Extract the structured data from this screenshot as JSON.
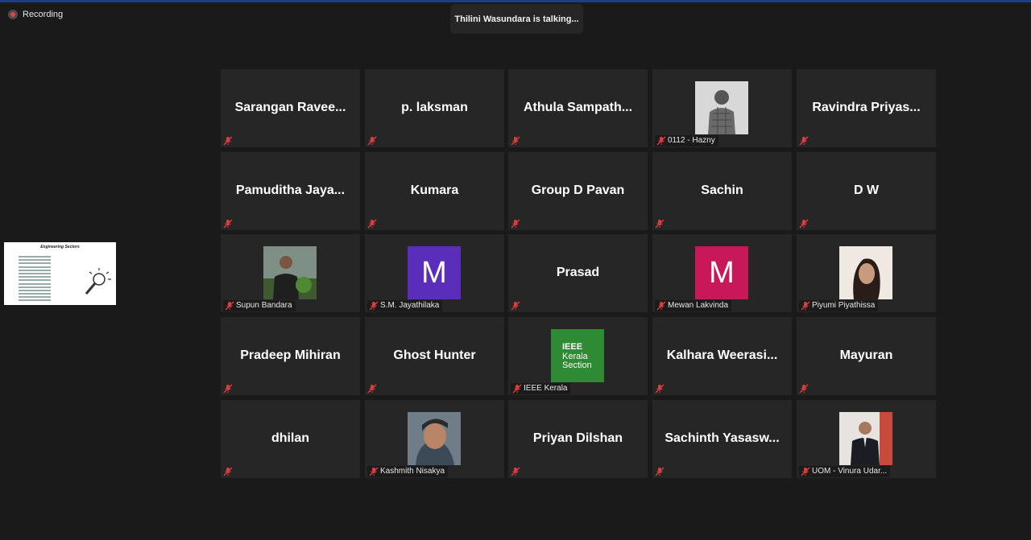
{
  "recording_label": "Recording",
  "talking_banner": "Thilini Wasundara is talking...",
  "share_preview": {
    "title": "Engineering Sectors"
  },
  "colors": {
    "mute_icon": "#e03c3c",
    "avatar_purple": "#5a2dbb",
    "avatar_pink": "#c8185a",
    "ieee_green": "#2e8b34"
  },
  "tiles": [
    {
      "name": "Sarangan  Ravee..."
    },
    {
      "name": "p. laksman"
    },
    {
      "name": "Athula  Sampath..."
    },
    {
      "label": "0112 - Hazny"
    },
    {
      "name": "Ravindra  Priyas..."
    },
    {
      "name": "Pamuditha  Jaya..."
    },
    {
      "name": "Kumara"
    },
    {
      "name": "Group D Pavan"
    },
    {
      "name": "Sachin"
    },
    {
      "name": "D W"
    },
    {
      "label": "Supun Bandara"
    },
    {
      "label": "S.M. Jayathilaka",
      "avatar_letter": "M"
    },
    {
      "name": "Prasad"
    },
    {
      "label": "Mewan Lakvinda",
      "avatar_letter": "M"
    },
    {
      "label": "Piyumi Piyathissa"
    },
    {
      "name": "Pradeep Mihiran"
    },
    {
      "name": "Ghost Hunter"
    },
    {
      "label": "IEEE Kerala",
      "logo_text": [
        "IEEE",
        "Kerala",
        "Section"
      ]
    },
    {
      "name": "Kalhara  Weerasi..."
    },
    {
      "name": "Mayuran"
    },
    {
      "name": "dhilan"
    },
    {
      "label": "Kashmith Nisakya"
    },
    {
      "name": "Priyan Dilshan"
    },
    {
      "name": "Sachinth  Yasasw..."
    },
    {
      "label": "UOM - Vinura Udar..."
    }
  ]
}
